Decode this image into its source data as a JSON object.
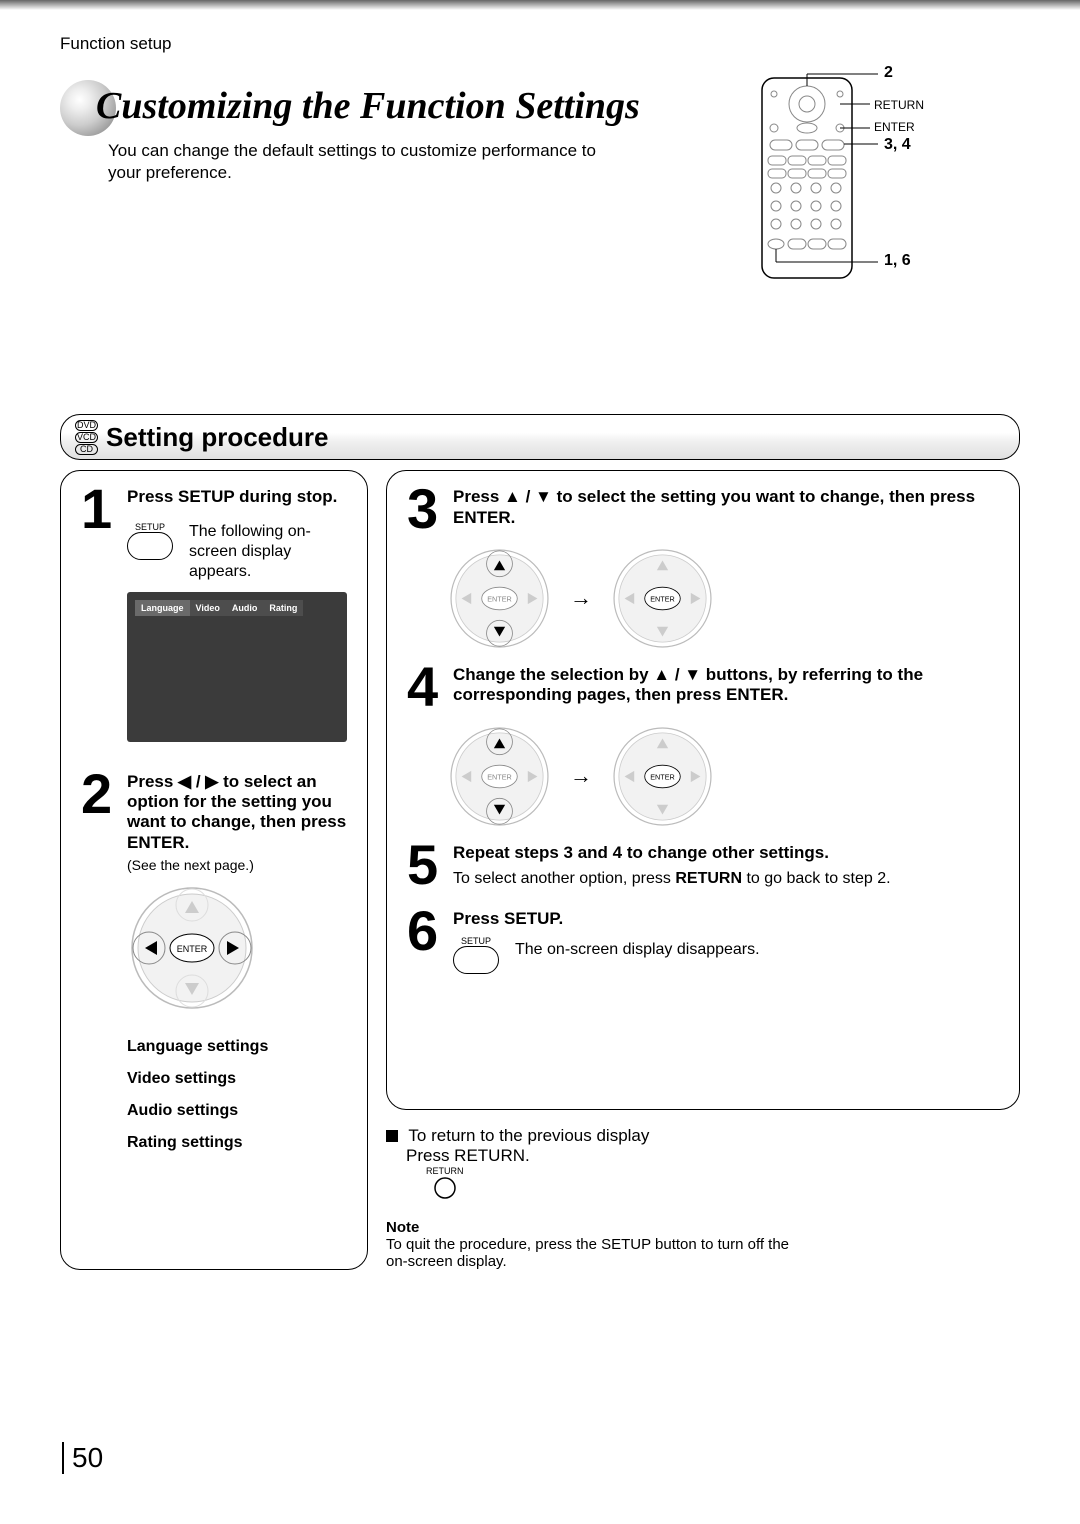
{
  "header": {
    "label": "Function setup"
  },
  "title": "Customizing the Function Settings",
  "intro": "You can change the default settings to customize performance to your preference.",
  "remote": {
    "callouts": {
      "c2": "2",
      "c34": "3, 4",
      "c16": "1, 6"
    },
    "labels": {
      "return": "RETURN",
      "enter": "ENTER"
    }
  },
  "discs": {
    "dvd": "DVD",
    "vcd": "VCD",
    "cd": "CD"
  },
  "section_title": "Setting procedure",
  "screen_tabs": {
    "lang": "Language",
    "video": "Video",
    "audio": "Audio",
    "rating": "Rating"
  },
  "steps": {
    "s1": {
      "num": "1",
      "title": "Press SETUP during stop.",
      "btn_label": "SETUP",
      "desc": "The following on-screen display appears."
    },
    "s2": {
      "num": "2",
      "title": "Press ◀ / ▶ to select an option for the setting you want to change, then press ENTER.",
      "note": "(See the next page.)",
      "list": {
        "lang": "Language settings",
        "video": "Video settings",
        "audio": "Audio settings",
        "rating": "Rating settings"
      }
    },
    "s3": {
      "num": "3",
      "title": "Press ▲ / ▼ to select the setting you want to change, then press ENTER."
    },
    "s4": {
      "num": "4",
      "title": "Change the selection by ▲ / ▼ buttons, by referring to the corresponding pages, then press ENTER."
    },
    "s5": {
      "num": "5",
      "title": "Repeat steps 3 and 4 to change other settings.",
      "desc_prefix": "To select another option, press ",
      "desc_bold": "RETURN",
      "desc_suffix": " to go back to step 2."
    },
    "s6": {
      "num": "6",
      "title": "Press SETUP.",
      "btn_label": "SETUP",
      "desc": "The on-screen display disappears."
    }
  },
  "return_block": {
    "heading": "To return to the previous display",
    "line": "Press RETURN.",
    "btn_label": "RETURN"
  },
  "note": {
    "title": "Note",
    "body": "To quit the procedure, press the SETUP button to turn off the on-screen display."
  },
  "enter_label": "ENTER",
  "page_number": "50"
}
